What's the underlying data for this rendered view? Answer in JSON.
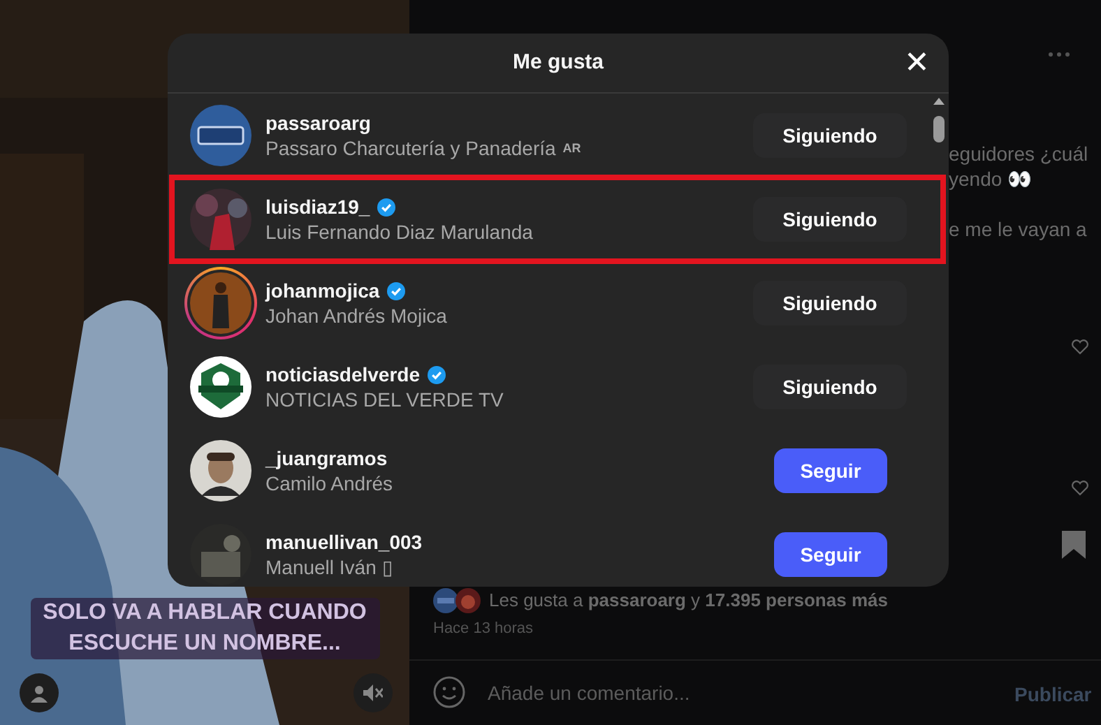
{
  "post": {
    "caption_lines": [
      "eguidores ¿cuál",
      "yendo 👀",
      "e me le vayan a"
    ],
    "video_caption": "SOLO VA A HABLAR CUANDO ESCUCHE UN NOMBRE...",
    "likes_prefix": "Les gusta a ",
    "likes_user": "passaroarg",
    "likes_middle": " y ",
    "likes_count": "17.395 personas más",
    "time": "Hace 13 horas",
    "comment_placeholder": "Añade un comentario...",
    "publish": "Publicar"
  },
  "dialog": {
    "title": "Me gusta",
    "close": "✕",
    "rows": [
      {
        "username": "passaroarg",
        "verified": false,
        "full_name": "Passaro Charcutería y Panadería",
        "tag": "AR",
        "story_ring": false,
        "highlighted": false,
        "button": {
          "label": "Siguiendo",
          "kind": "following"
        }
      },
      {
        "username": "luisdiaz19_",
        "verified": true,
        "full_name": "Luis Fernando Diaz Marulanda",
        "story_ring": false,
        "highlighted": true,
        "button": {
          "label": "Siguiendo",
          "kind": "following"
        }
      },
      {
        "username": "johanmojica",
        "verified": true,
        "full_name": "Johan Andrés Mojica",
        "story_ring": true,
        "highlighted": false,
        "button": {
          "label": "Siguiendo",
          "kind": "following"
        }
      },
      {
        "username": "noticiasdelverde",
        "verified": true,
        "full_name": "NOTICIAS DEL VERDE TV",
        "story_ring": false,
        "highlighted": false,
        "button": {
          "label": "Siguiendo",
          "kind": "following"
        }
      },
      {
        "username": "_juangramos",
        "verified": false,
        "full_name": "Camilo Andrés",
        "story_ring": false,
        "highlighted": false,
        "button": {
          "label": "Seguir",
          "kind": "follow"
        }
      },
      {
        "username": "manuellivan_003",
        "verified": false,
        "full_name": "Manuell Iván ▯",
        "story_ring": false,
        "highlighted": false,
        "button": {
          "label": "Seguir",
          "kind": "follow"
        }
      }
    ]
  }
}
